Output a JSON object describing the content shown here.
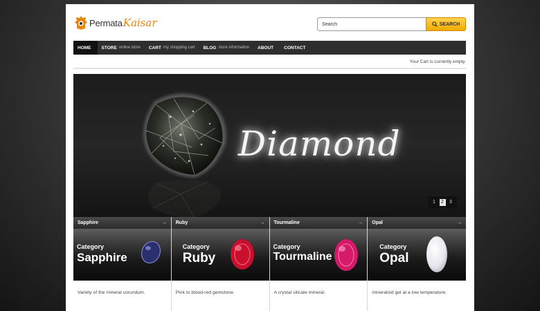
{
  "logo": {
    "part1": "Permata",
    "part2": "Kaisar"
  },
  "search": {
    "placeholder": "Search",
    "button_label": "SEARCH"
  },
  "nav": [
    {
      "label": "HOME",
      "sub": ""
    },
    {
      "label": "STORE",
      "sub": "online store"
    },
    {
      "label": "CART",
      "sub": "my shopping cart"
    },
    {
      "label": "BLOG",
      "sub": "store information"
    },
    {
      "label": "ABOUT",
      "sub": ""
    },
    {
      "label": "CONTACT",
      "sub": ""
    }
  ],
  "cart_status": "Your Cart is currently empty.",
  "slider": {
    "title": "Diamond",
    "pages": [
      "1",
      "2",
      "3"
    ],
    "active_page": "2"
  },
  "categories": [
    {
      "name": "Sapphire",
      "prefix": "Category",
      "title": "Sapphire",
      "desc": "Variety of the mineral corundum.",
      "stone_color": "#2a2f6e"
    },
    {
      "name": "Ruby",
      "prefix": "Category",
      "title": "Ruby",
      "desc": "Pink to blood-red gemstone.",
      "stone_color": "#c8102e"
    },
    {
      "name": "Tourmaline",
      "prefix": "Category",
      "title": "Tourmaline",
      "desc": "A crystal silicate mineral.",
      "stone_color": "#d61a6a"
    },
    {
      "name": "Opal",
      "prefix": "Category",
      "title": "Opal",
      "desc": "mineraloid gel at a low temperature.",
      "stone_color": "#f2f2f4"
    }
  ],
  "colors": {
    "accent": "#f2a900",
    "logo_orange": "#e8860b",
    "nav_bg": "#2e2e2e"
  },
  "icons": {
    "search": "search-icon",
    "arrow": "arrow-right-icon"
  }
}
